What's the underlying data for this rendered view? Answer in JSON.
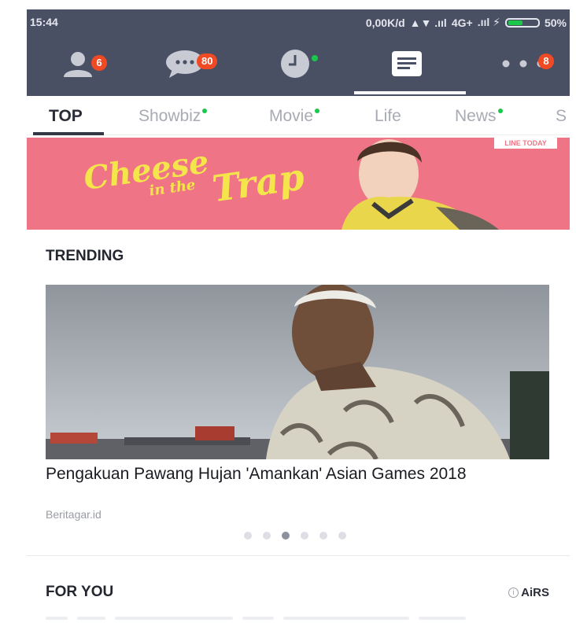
{
  "status_bar": {
    "time": "15:44",
    "network": "0,00K/d",
    "signal_text": "4G+",
    "battery_percent": "50%",
    "battery_level": 0.5
  },
  "top_tabs": [
    {
      "icon": "friends-icon",
      "badge": "6"
    },
    {
      "icon": "chat-icon",
      "badge": "80"
    },
    {
      "icon": "timeline-icon",
      "badge": ""
    },
    {
      "icon": "news-icon",
      "badge": "",
      "active": true
    },
    {
      "icon": "more-icon",
      "badge": "8"
    }
  ],
  "category_tabs": [
    {
      "label": "TOP",
      "active": true
    },
    {
      "label": "Showbiz",
      "new": true
    },
    {
      "label": "Movie",
      "new": true
    },
    {
      "label": "Life"
    },
    {
      "label": "News",
      "new": true
    },
    {
      "label": "S"
    }
  ],
  "banner": {
    "title_line1": "Cheese",
    "title_line2": "in the",
    "title_line3": "Trap",
    "channel_logo": "LINE TODAY"
  },
  "trending": {
    "section_title": "TRENDING",
    "headline": "Pengakuan Pawang Hujan 'Amankan' Asian Games 2018",
    "source": "Beritagar.id",
    "carousel_count": 6,
    "carousel_active": 2
  },
  "for_you": {
    "section_title": "FOR YOU",
    "airs_label": "AiRS",
    "info_glyph": "i"
  },
  "colors": {
    "header_bg": "#4a5064",
    "badge": "#f04a24",
    "new_dot": "#19c84a",
    "banner_bg": "#ef7586"
  }
}
